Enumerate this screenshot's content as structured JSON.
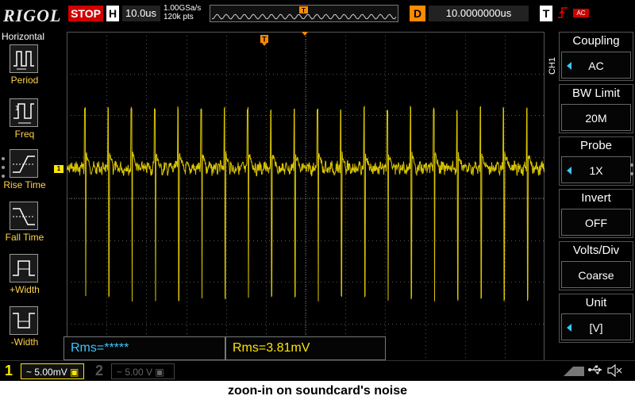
{
  "brand": "RIGOL",
  "run_state": "STOP",
  "horizontal": {
    "label": "H",
    "timebase": "10.0us",
    "sample_rate": "1.00GSa/s",
    "mem_depth": "120k pts"
  },
  "delay": {
    "label": "D",
    "value": "10.0000000us"
  },
  "trigger": {
    "label": "T",
    "source": "AC",
    "edge_icon": "rising-edge-icon",
    "marker": "T"
  },
  "left_menu": {
    "title": "Horizontal",
    "items": [
      {
        "label": "Period",
        "icon": "period-icon"
      },
      {
        "label": "Freq",
        "icon": "freq-icon"
      },
      {
        "label": "Rise Time",
        "icon": "rise-time-icon"
      },
      {
        "label": "Fall Time",
        "icon": "fall-time-icon"
      },
      {
        "label": "+Width",
        "icon": "pos-width-icon"
      },
      {
        "label": "-Width",
        "icon": "neg-width-icon"
      }
    ]
  },
  "right_menu": {
    "channel_tab": "CH1",
    "items": [
      {
        "title": "Coupling",
        "value": "AC",
        "has_arrow": true
      },
      {
        "title": "BW Limit",
        "value": "20M",
        "has_arrow": false
      },
      {
        "title": "Probe",
        "value": "1X",
        "has_arrow": true
      },
      {
        "title": "Invert",
        "value": "OFF",
        "has_arrow": false
      },
      {
        "title": "Volts/Div",
        "value": "Coarse",
        "has_arrow": false
      },
      {
        "title": "Unit",
        "value": "[V]",
        "has_arrow": true
      }
    ]
  },
  "measurements": [
    {
      "text": "Rms=*****",
      "color": "#39c6ff"
    },
    {
      "text": "Rms=3.81mV",
      "color": "#ffe600"
    }
  ],
  "channels": [
    {
      "num": "1",
      "scale": "~ 5.00mV",
      "active": true
    },
    {
      "num": "2",
      "scale": "~ 5.00 V",
      "active": false
    }
  ],
  "channel_marker": "1",
  "colors": {
    "ch1": "#ffe600",
    "ch2_dim": "#4a4a4a",
    "accent_blue": "#39c6ff",
    "trigger_orange": "#ff8a00",
    "stop_red": "#d10000"
  },
  "status_icons": [
    "usb-icon",
    "speaker-mute-icon"
  ],
  "caption": "zoon-in on soundcard's noise"
}
